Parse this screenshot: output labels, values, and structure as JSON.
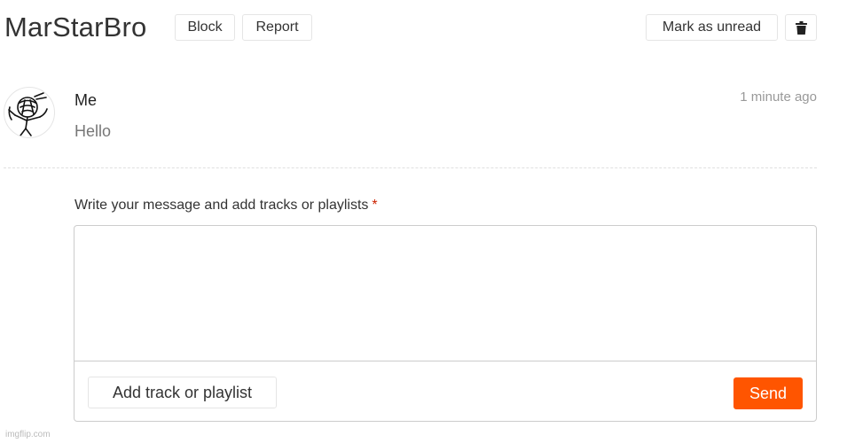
{
  "header": {
    "conversation_title": "MarStarBro",
    "block_label": "Block",
    "report_label": "Report",
    "mark_unread_label": "Mark as unread",
    "delete_icon": "trash-icon"
  },
  "message": {
    "avatar_icon": "user-avatar",
    "sender": "Me",
    "timestamp": "1 minute ago",
    "text": "Hello"
  },
  "compose": {
    "label": "Write your message and add tracks or playlists",
    "required_marker": "*",
    "textarea_value": "",
    "add_track_label": "Add track or playlist",
    "send_label": "Send"
  },
  "colors": {
    "accent": "#ff5500",
    "required": "#cc2200"
  },
  "watermark": "imgflip.com"
}
